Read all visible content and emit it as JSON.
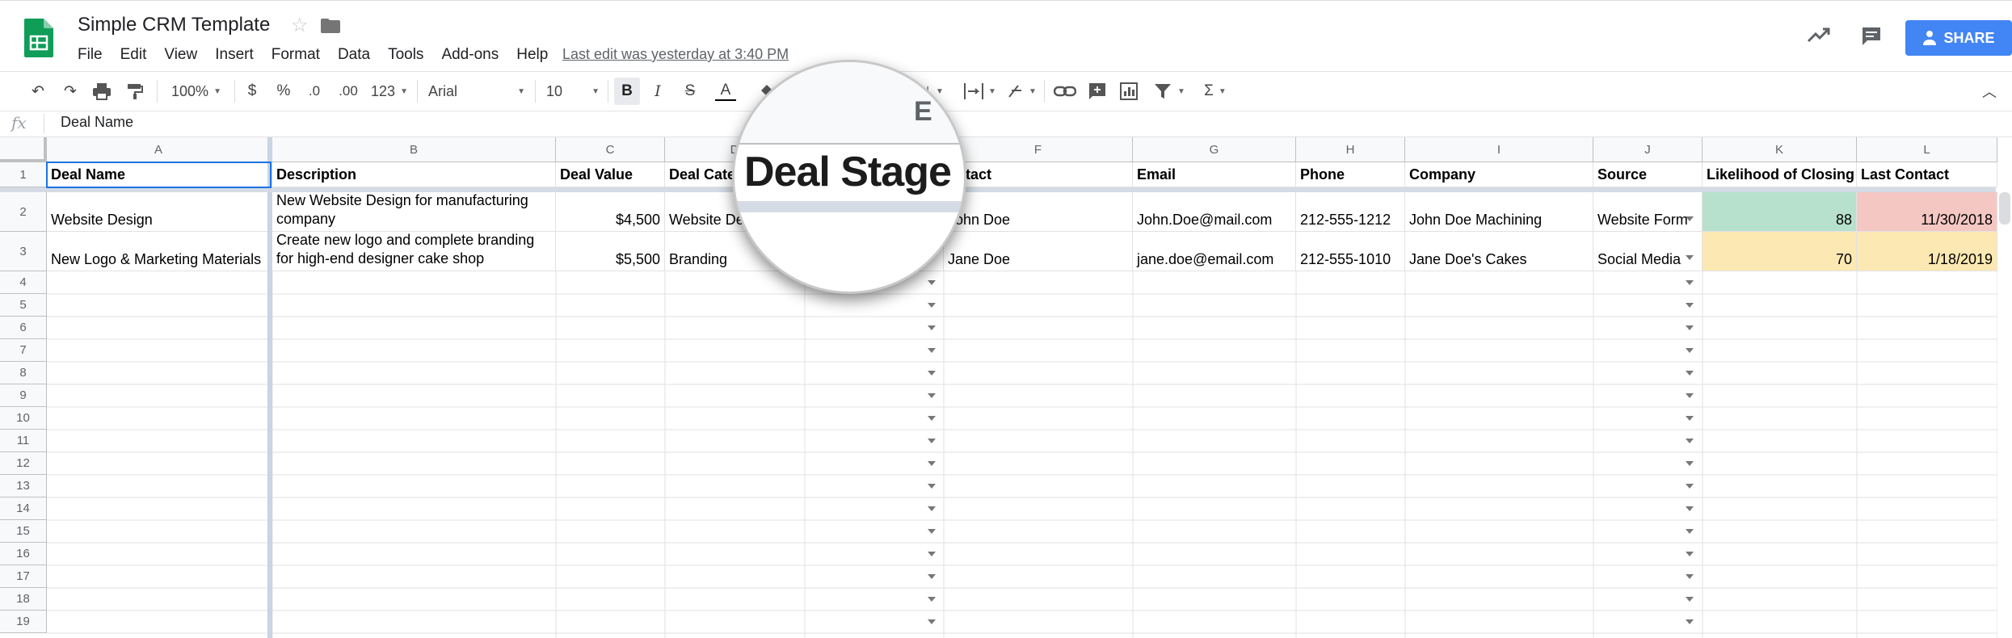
{
  "doc": {
    "title": "Simple CRM Template",
    "last_edit": "Last edit was yesterday at 3:40 PM"
  },
  "menu": [
    "File",
    "Edit",
    "View",
    "Insert",
    "Format",
    "Data",
    "Tools",
    "Add-ons",
    "Help"
  ],
  "share_label": "SHARE",
  "toolbar": {
    "zoom": "100%",
    "currency": "$",
    "percent": "%",
    "dec_less": ".0",
    "dec_more": ".00",
    "more_formats": "123",
    "font": "Arial",
    "font_size": "10",
    "bold": "B",
    "italic": "I",
    "strike": "S",
    "text_color": "A",
    "sum": "Σ"
  },
  "formula_bar": {
    "fx": "fx",
    "value": "Deal Name"
  },
  "columns": [
    "A",
    "B",
    "C",
    "D",
    "E",
    "F",
    "G",
    "H",
    "I",
    "J",
    "K",
    "L"
  ],
  "rows": [
    "1",
    "2",
    "3",
    "4",
    "5",
    "6",
    "7",
    "8",
    "9",
    "10",
    "11",
    "12",
    "13",
    "14",
    "15",
    "16",
    "17",
    "18",
    "19"
  ],
  "headers": [
    "Deal Name",
    "Description",
    "Deal Value",
    "Deal Cate",
    "",
    "ontact",
    "Email",
    "Phone",
    "Company",
    "Source",
    "Likelihood of Closing",
    "Last Contact"
  ],
  "data": [
    {
      "deal_name": "Website Design",
      "description": "New Website Design for manufacturing company",
      "deal_value": "$4,500",
      "deal_category": "Website De",
      "contact": "John Doe",
      "email": "John.Doe@mail.com",
      "phone": "212-555-1212",
      "company": "John Doe Machining",
      "source": "Website Form",
      "likelihood": "88",
      "last_contact": "11/30/2018"
    },
    {
      "deal_name": "New Logo & Marketing Materials",
      "description": "Create new logo and complete branding for high-end designer cake shop",
      "deal_value": "$5,500",
      "deal_category": "Branding",
      "contact": "Jane Doe",
      "email": "jane.doe@email.com",
      "phone": "212-555-1010",
      "company": "Jane Doe's Cakes",
      "source": "Social Media",
      "likelihood": "70",
      "last_contact": "1/18/2019"
    }
  ],
  "magnifier": {
    "column_letter": "E",
    "text": "Deal Stage"
  },
  "colors": {
    "sheets_green": "#0f9d58",
    "share_blue": "#4285f4",
    "likelihood_high": "#b7e1cd",
    "last_contact_old": "#f4c7c3",
    "highlight_yellow": "#fce8b2"
  }
}
